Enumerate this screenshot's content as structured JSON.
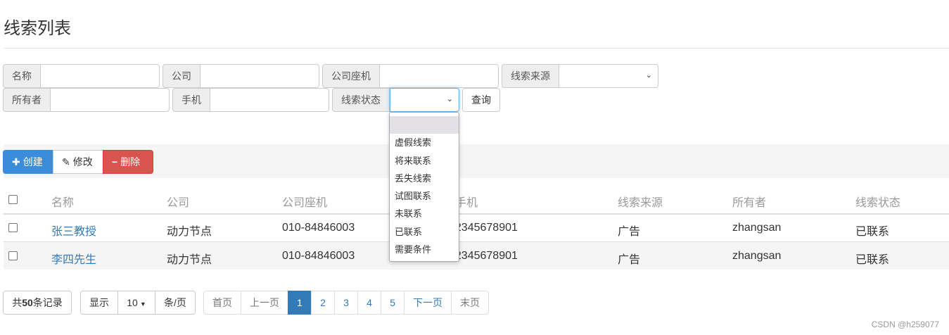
{
  "page": {
    "title": "线索列表"
  },
  "search": {
    "name_label": "名称",
    "company_label": "公司",
    "phone_label": "公司座机",
    "source_label": "线索来源",
    "owner_label": "所有者",
    "mobile_label": "手机",
    "state_label": "线索状态",
    "query_button": "查询"
  },
  "state_dropdown": {
    "options": [
      "",
      "虚假线索",
      "将来联系",
      "丢失线索",
      "试图联系",
      "未联系",
      "已联系",
      "需要条件"
    ]
  },
  "toolbar": {
    "create_label": "创建",
    "edit_label": "修改",
    "delete_label": "删除",
    "create_color": "#3c8dd9",
    "delete_color": "#d9534f"
  },
  "table": {
    "headers": [
      "名称",
      "公司",
      "公司座机",
      "手机",
      "线索来源",
      "所有者",
      "线索状态"
    ],
    "rows": [
      [
        "张三教授",
        "动力节点",
        "010-84846003",
        "12345678901",
        "广告",
        "zhangsan",
        "已联系"
      ],
      [
        "李四先生",
        "动力节点",
        "010-84846003",
        "12345678901",
        "广告",
        "zhangsan",
        "已联系"
      ]
    ]
  },
  "pagination": {
    "total_prefix": "共",
    "total_count": "50",
    "total_suffix": "条记录",
    "show_label": "显示",
    "page_size": "10",
    "per_page_label": "条/页",
    "first_label": "首页",
    "prev_label": "上一页",
    "pages": [
      "1",
      "2",
      "3",
      "4",
      "5"
    ],
    "current_page": "1",
    "next_label": "下一页",
    "last_label": "末页"
  },
  "watermark": "CSDN @h259077"
}
